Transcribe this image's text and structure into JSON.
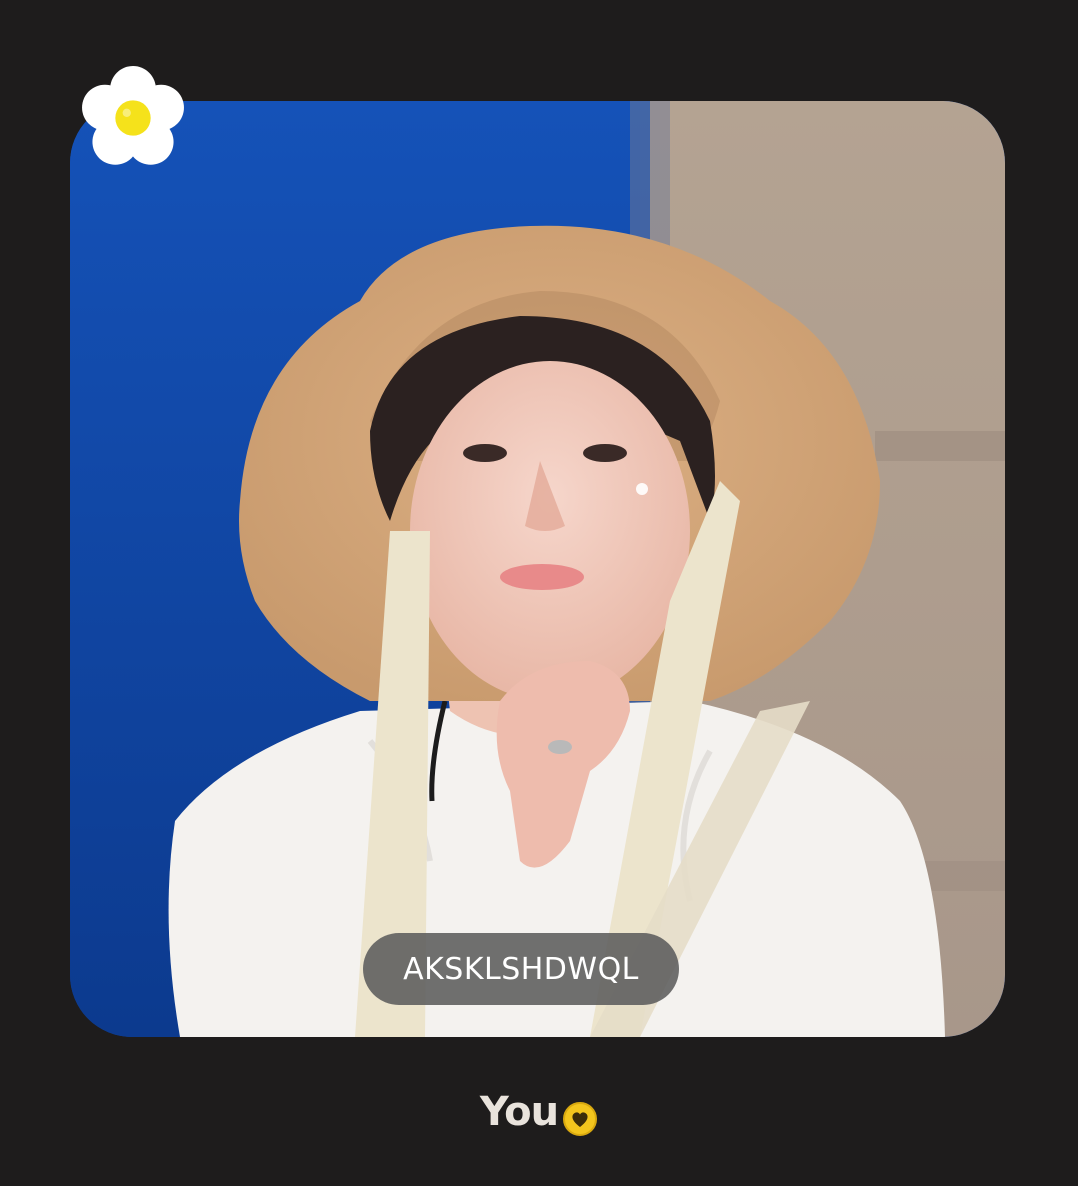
{
  "card": {
    "name_label": "AKSKLSHDWQL",
    "photo_description_icon": "portrait-photo"
  },
  "sticker": {
    "icon": "daisy-flower-icon",
    "petal_color": "#ffffff",
    "center_color": "#f5e21b"
  },
  "footer": {
    "label": "You",
    "badge_icon": "heart-badge-icon",
    "badge_color": "#f3c51d"
  },
  "colors": {
    "background": "#1e1c1c",
    "photo_backdrop_left": "#0f3f9c",
    "photo_backdrop_right": "#b09f8f",
    "pill_background": "#5c5c5c"
  }
}
